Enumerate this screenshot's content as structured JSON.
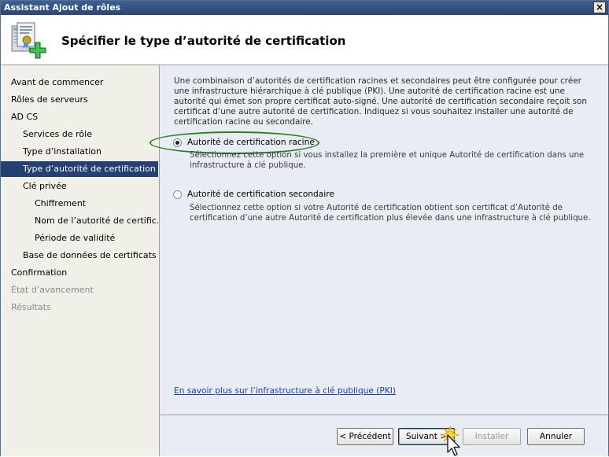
{
  "window": {
    "title": "Assistant Ajout de rôles",
    "close_glyph": "×"
  },
  "header": {
    "title": "Spécifier le type d’autorité de certification",
    "icon": "certificate-add-icon"
  },
  "sidebar": {
    "items": [
      {
        "label": "Avant de commencer",
        "state": "normal"
      },
      {
        "label": "Rôles de serveurs",
        "state": "normal"
      },
      {
        "label": "AD CS",
        "state": "normal"
      },
      {
        "label": "Services de rôle",
        "state": "normal"
      },
      {
        "label": "Type d’installation",
        "state": "normal"
      },
      {
        "label": "Type d’autorité de certification",
        "state": "selected"
      },
      {
        "label": "Clé privée",
        "state": "normal"
      },
      {
        "label": "Chiffrement",
        "state": "normal"
      },
      {
        "label": "Nom de l’autorité de certific...",
        "state": "normal"
      },
      {
        "label": "Période de validité",
        "state": "normal"
      },
      {
        "label": "Base de données de certificats",
        "state": "normal"
      },
      {
        "label": "Confirmation",
        "state": "normal"
      },
      {
        "label": "État d’avancement",
        "state": "disabled"
      },
      {
        "label": "Résultats",
        "state": "disabled"
      }
    ]
  },
  "main": {
    "description": "Une combinaison d’autorités de certification racines et secondaires peut être configurée pour créer une infrastructure hiérarchique à clé publique (PKI). Une autorité de certification racine est une autorité qui émet son propre certificat auto-signé. Une autorité de certification secondaire reçoit son certificat d’une autre autorité de certification. Indiquez si vous souhaitez installer une autorité de certification racine ou secondaire.",
    "options": [
      {
        "label": "Autorité de certification racine",
        "description": "Sélectionnez cette option si vous installez la première et unique Autorité de certification dans une infrastructure à clé publique.",
        "selected": true
      },
      {
        "label": "Autorité de certification secondaire",
        "description": "Sélectionnez cette option si votre Autorité de certification obtient son certificat d’Autorité de certification d’une autre Autorité de certification plus élevée dans une infrastructure à clé publique.",
        "selected": false
      }
    ],
    "link": "En savoir plus sur l’infrastructure à clé publique (PKI)"
  },
  "buttons": {
    "previous": "< Précédent",
    "next": "Suivant >",
    "install": "Installer",
    "cancel": "Annuler"
  },
  "colors": {
    "selection": "#253f72",
    "highlight_ring": "#2f7d22",
    "link": "#1f3ea6"
  }
}
